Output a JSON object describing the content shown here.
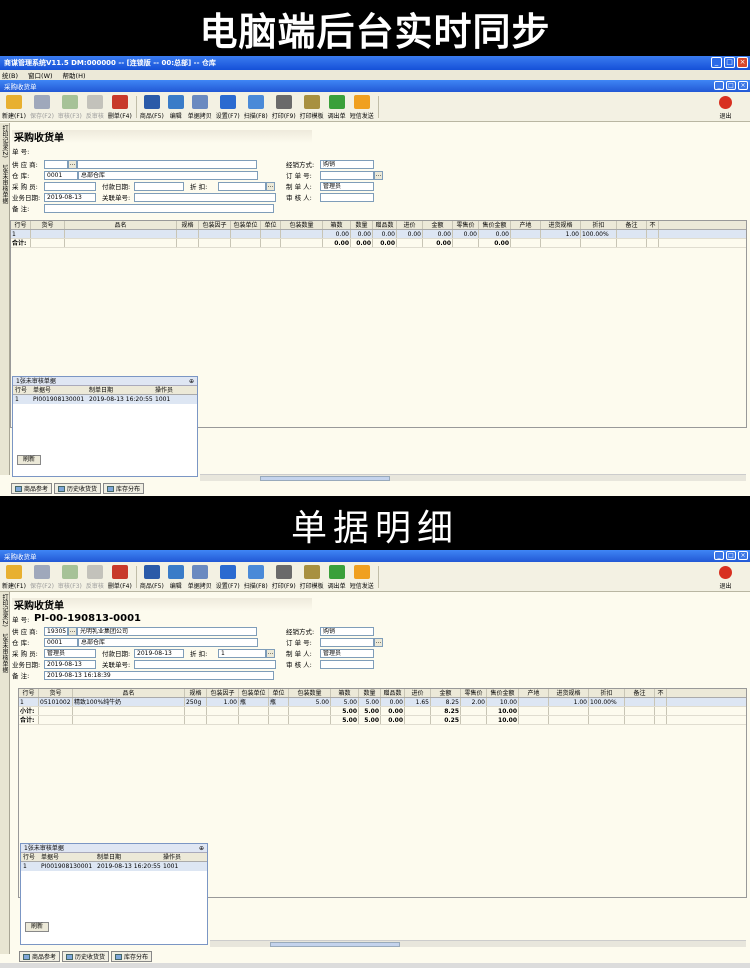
{
  "banners": {
    "top": "电脑端后台实时同步",
    "middle": "单据明细"
  },
  "colors": {
    "titlebar": "#2458d8",
    "window_bg": "#fdfbee",
    "selected_row": "#dde6f3",
    "close": "#d8472c"
  },
  "app": {
    "title": "商谋管理系统V11.5 DM:000000 -- [连锁版 -- 00:总部] -- 仓库",
    "menu": [
      "统(B)",
      "窗口(W)",
      "帮助(H)"
    ]
  },
  "toolbar": [
    {
      "label": "新建(F1)",
      "icon": "folder-open-icon",
      "enabled": true
    },
    {
      "label": "保存(F2)",
      "icon": "save-icon",
      "enabled": false
    },
    {
      "label": "审核(F3)",
      "icon": "approve-icon",
      "enabled": false
    },
    {
      "label": "反审核",
      "icon": "unapprove-icon",
      "enabled": false
    },
    {
      "label": "删单(F4)",
      "icon": "delete-doc-icon",
      "enabled": true
    },
    {
      "label": "商品(F5)",
      "icon": "goods-icon",
      "enabled": true
    },
    {
      "label": "编辑",
      "icon": "edit-icon",
      "enabled": true
    },
    {
      "label": "单据拷贝",
      "icon": "copy-doc-icon",
      "enabled": true
    },
    {
      "label": "设置(F7)",
      "icon": "settings-icon",
      "enabled": true
    },
    {
      "label": "扫描(F8)",
      "icon": "scan-icon",
      "enabled": true
    },
    {
      "label": "打印(F9)",
      "icon": "print-icon",
      "enabled": true
    },
    {
      "label": "打印模板",
      "icon": "print-template-icon",
      "enabled": true
    },
    {
      "label": "调出单",
      "icon": "transfer-icon",
      "enabled": true
    },
    {
      "label": "短信发送",
      "icon": "sms-icon",
      "enabled": true
    }
  ],
  "exit_label": "退出",
  "form_window_title": "采购收货单",
  "form_title": "采购收货单",
  "sidebar_text": {
    "top": "打印记录(Z)",
    "middle": "1张未审核单据"
  },
  "form_labels": {
    "doc_no": "单 号:",
    "supplier": "供 应 商:",
    "warehouse": "仓    库:",
    "buyer": "采 购 员:",
    "pay_date": "付款日期:",
    "discount": "折    扣:",
    "biz_date": "业务日期:",
    "related_no": "关联单号:",
    "remark": "备    注:",
    "biz_mode": "经销方式:",
    "order_no": "订 单 号:",
    "maker": "制 单 人:",
    "reviewer": "审 核 人:"
  },
  "grid_headers": [
    "行号",
    "货号",
    "品名",
    "规格",
    "包装因子",
    "包装单位",
    "单位",
    "包装数量",
    "箱数",
    "数量",
    "赠品数",
    "进价",
    "金额",
    "零售价",
    "售价金额",
    "产地",
    "进货规格",
    "折扣",
    "备注",
    "不"
  ],
  "panel_headers": [
    "行号",
    "单据号",
    "制单日期",
    "操作员"
  ],
  "bottom_tabs": [
    "商品参考",
    "历史收货货",
    "库存分布"
  ],
  "refresh_label": "刷新",
  "screen1": {
    "doc_no": "",
    "supplier_code": "",
    "supplier_name": "",
    "warehouse_code": "0001",
    "warehouse_name": "总部仓库",
    "buyer": "",
    "pay_date": "",
    "discount": "",
    "biz_date": "2019-08-13",
    "related_no": "",
    "remark": "",
    "biz_mode": "购销",
    "order_no": "",
    "maker": "管理员",
    "reviewer": "",
    "rows": [
      [
        "1",
        "",
        "",
        "",
        "",
        "",
        "",
        "",
        "0.00",
        "0.00",
        "0.00",
        "0.00",
        "0.00",
        "0.00",
        "0.00",
        "",
        "1.00",
        "100.00%",
        "",
        ""
      ]
    ],
    "totals": [
      [
        "合计:",
        "",
        "",
        "",
        "",
        "",
        "",
        "",
        "0.00",
        "0.00",
        "0.00",
        "",
        "0.00",
        "",
        "0.00",
        "",
        "",
        "",
        "",
        ""
      ]
    ],
    "panel": {
      "title": "1张未审核单据",
      "rows": [
        [
          "1",
          "PI001908130001",
          "2019-08-13 16:20:55",
          "1001"
        ]
      ]
    }
  },
  "screen2": {
    "doc_no": "PI-00-190813-0001",
    "supplier_code": "19305",
    "supplier_name": "光明乳业集团公司",
    "warehouse_code": "0001",
    "warehouse_name": "总部仓库",
    "buyer": "管理员",
    "pay_date": "2019-08-13",
    "discount": "1",
    "biz_date": "2019-08-13",
    "related_no": "",
    "remark": "2019-08-13 16:18:39",
    "biz_mode": "购销",
    "order_no": "",
    "maker": "管理员",
    "reviewer": "",
    "rows": [
      [
        "1",
        "05101002",
        "精致100%纯牛奶",
        "250g",
        "1.00",
        "瓶",
        "瓶",
        "5.00",
        "5.00",
        "5.00",
        "0.00",
        "1.65",
        "8.25",
        "2.00",
        "10.00",
        "",
        "1.00",
        "100.00%",
        "",
        ""
      ]
    ],
    "totals": [
      [
        "小计:",
        "",
        "",
        "",
        "",
        "",
        "",
        "",
        "5.00",
        "5.00",
        "0.00",
        "",
        "8.25",
        "",
        "10.00",
        "",
        "",
        "",
        "",
        ""
      ],
      [
        "合计:",
        "",
        "",
        "",
        "",
        "",
        "",
        "",
        "5.00",
        "5.00",
        "0.00",
        "",
        "0.25",
        "",
        "10.00",
        "",
        "",
        "",
        "",
        ""
      ]
    ],
    "panel": {
      "title": "1张未审核单据",
      "rows": [
        [
          "1",
          "PI001908130001",
          "2019-08-13 16:20:55",
          "1001"
        ]
      ]
    }
  }
}
